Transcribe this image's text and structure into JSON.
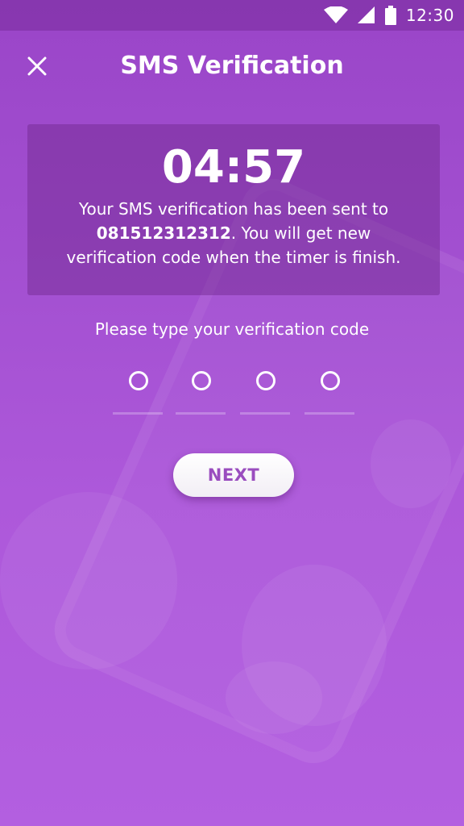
{
  "status_bar": {
    "time": "12:30",
    "icons": [
      "wifi-icon",
      "cellular-signal-icon",
      "battery-icon"
    ]
  },
  "header": {
    "title": "SMS Verification",
    "close_icon": "close-icon"
  },
  "timer": {
    "value": "04:57",
    "message_prefix": "Your SMS verification has been sent to",
    "phone_number": "081512312312",
    "message_suffix": ". You will get new verification code when the timer is finish."
  },
  "verification": {
    "prompt": "Please type your verification code",
    "code_length": 4,
    "code_values": [
      "",
      "",
      "",
      ""
    ]
  },
  "actions": {
    "next_label": "NEXT"
  },
  "colors": {
    "background_top": "#9a45c8",
    "background_bottom": "#b35fe0",
    "button_text": "#9a4dbf",
    "text": "#ffffff"
  }
}
